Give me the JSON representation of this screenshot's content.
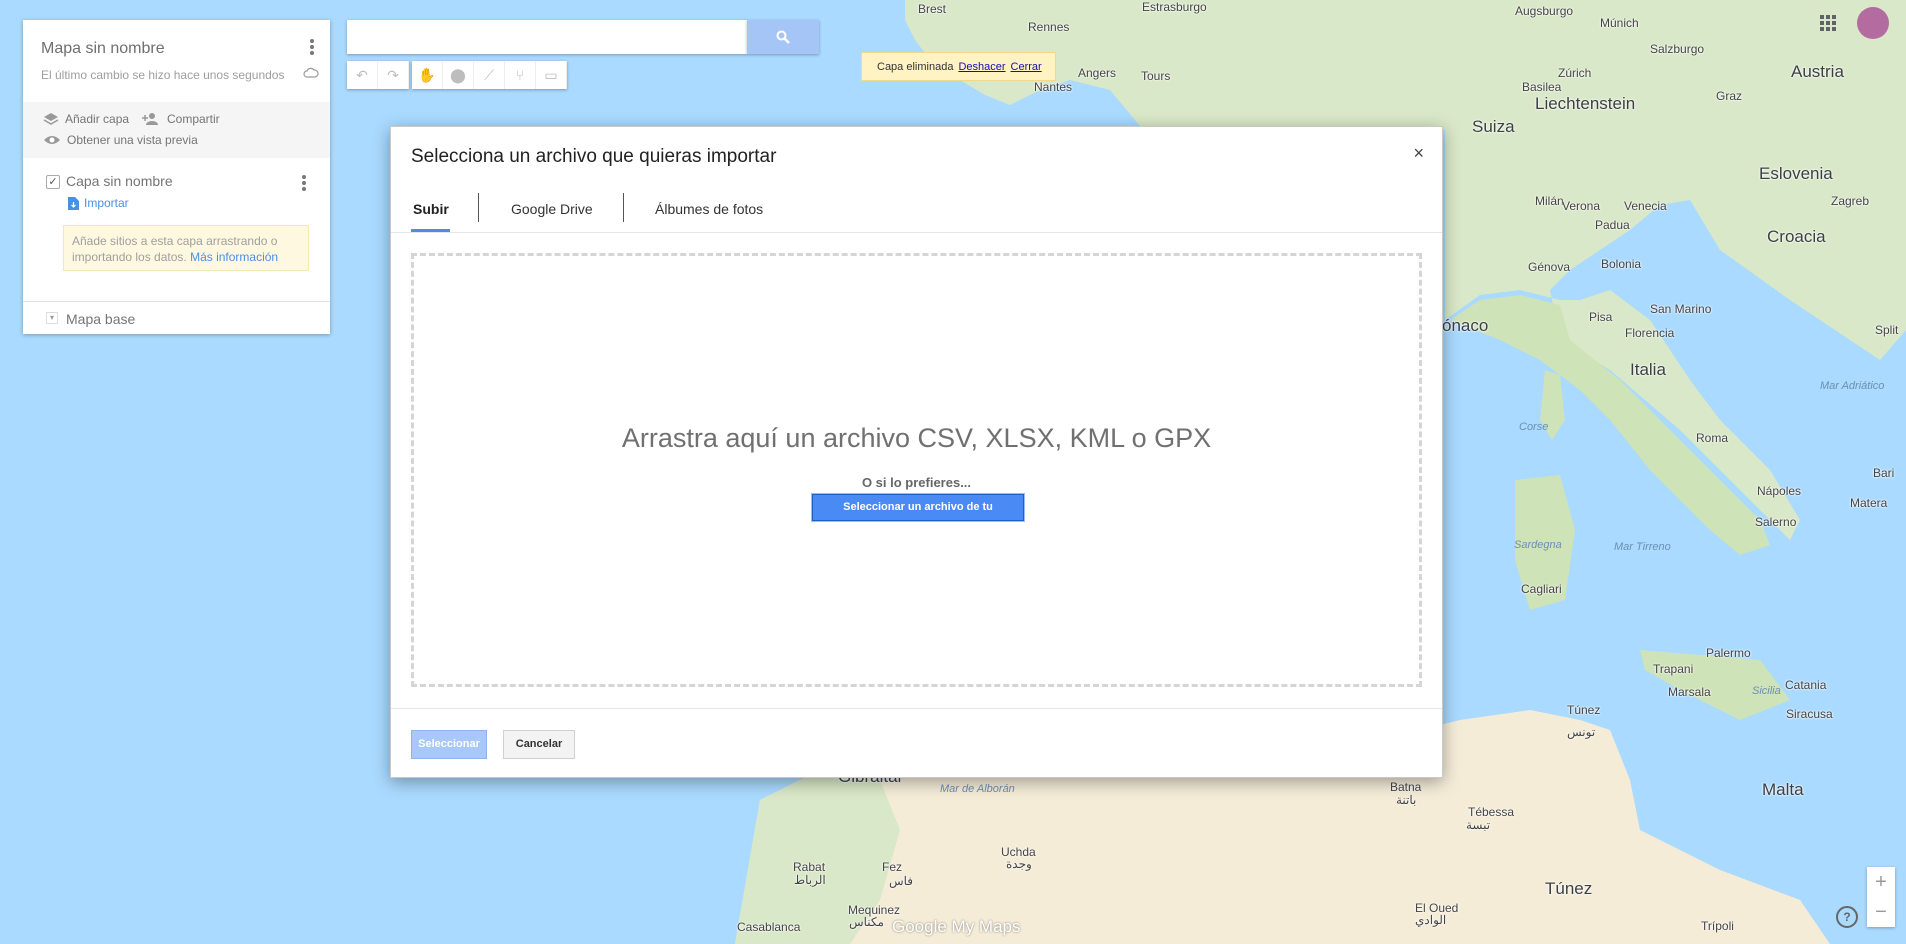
{
  "panel": {
    "title": "Mapa sin nombre",
    "subtitle": "El último cambio se hizo hace unos segundos",
    "actions": {
      "add_layer": "Añadir capa",
      "share": "Compartir",
      "preview": "Obtener una vista previa"
    },
    "layer": {
      "name": "Capa sin nombre",
      "import": "Importar",
      "hint": "Añade sitios a esta capa arrastrando o importando los datos.",
      "hint_link": "Más información"
    },
    "basemap": "Mapa base"
  },
  "search": {
    "placeholder": ""
  },
  "notice": {
    "text": "Capa eliminada",
    "undo": "Deshacer",
    "close": "Cerrar"
  },
  "modal": {
    "title": "Selecciona un archivo que quieras importar",
    "close_glyph": "×",
    "tabs": [
      "Subir",
      "Google Drive",
      "Álbumes de fotos"
    ],
    "drop_text": "Arrastra aquí un archivo CSV, XLSX, KML o GPX",
    "or_text": "O si lo prefieres...",
    "pick_button": "Seleccionar un archivo de tu dispositivo",
    "select_button": "Seleccionar",
    "cancel_button": "Cancelar"
  },
  "map": {
    "brand": "Google My Maps",
    "zoom_in": "+",
    "zoom_out": "−",
    "help": "?",
    "labels": [
      {
        "text": "Brest",
        "cls": "city"
      },
      {
        "text": "Rennes",
        "cls": "city"
      },
      {
        "text": "Nantes",
        "cls": "city"
      },
      {
        "text": "Angers",
        "cls": "city"
      },
      {
        "text": "Tours",
        "cls": "city"
      },
      {
        "text": "Estrasburgo",
        "cls": "city"
      },
      {
        "text": "Augsburgo",
        "cls": "city"
      },
      {
        "text": "Múnich",
        "cls": "city"
      },
      {
        "text": "Salzburgo",
        "cls": "city"
      },
      {
        "text": "Basilea",
        "cls": "city"
      },
      {
        "text": "Zúrich",
        "cls": "city"
      },
      {
        "text": "Liechtenstein",
        "cls": "country"
      },
      {
        "text": "Austria",
        "cls": "country"
      },
      {
        "text": "Graz",
        "cls": "city"
      },
      {
        "text": "Suiza",
        "cls": "country"
      },
      {
        "text": "Eslovenia",
        "cls": "country"
      },
      {
        "text": "Zagreb",
        "cls": "city"
      },
      {
        "text": "Milán",
        "cls": "city"
      },
      {
        "text": "Verona",
        "cls": "city"
      },
      {
        "text": "Venecia",
        "cls": "city"
      },
      {
        "text": "Padua",
        "cls": "city"
      },
      {
        "text": "Croacia",
        "cls": "country"
      },
      {
        "text": "Génova",
        "cls": "city"
      },
      {
        "text": "Bolonia",
        "cls": "city"
      },
      {
        "text": "ónaco",
        "cls": "country"
      },
      {
        "text": "San Marino",
        "cls": "city"
      },
      {
        "text": "Pisa",
        "cls": "city"
      },
      {
        "text": "Florencia",
        "cls": "city"
      },
      {
        "text": "Split",
        "cls": "city"
      },
      {
        "text": "Italia",
        "cls": "country"
      },
      {
        "text": "Mar Adriático",
        "cls": "sea"
      },
      {
        "text": "Corse",
        "cls": "sea"
      },
      {
        "text": "Roma",
        "cls": "city"
      },
      {
        "text": "Bari",
        "cls": "city"
      },
      {
        "text": "Nápoles",
        "cls": "city"
      },
      {
        "text": "Matera",
        "cls": "city"
      },
      {
        "text": "Salerno",
        "cls": "city"
      },
      {
        "text": "Sardegna",
        "cls": "sea"
      },
      {
        "text": "Mar Tirreno",
        "cls": "sea"
      },
      {
        "text": "Cagliari",
        "cls": "city"
      },
      {
        "text": "Palermo",
        "cls": "city"
      },
      {
        "text": "Trapani",
        "cls": "city"
      },
      {
        "text": "Marsala",
        "cls": "city"
      },
      {
        "text": "Sicilia",
        "cls": "sea"
      },
      {
        "text": "Catania",
        "cls": "city"
      },
      {
        "text": "Siracusa",
        "cls": "city"
      },
      {
        "text": "Túnez",
        "cls": "city"
      },
      {
        "text": "تونس",
        "cls": "city"
      },
      {
        "text": "Malta",
        "cls": "country"
      },
      {
        "text": "Gibraltar",
        "cls": "country"
      },
      {
        "text": "Mar de Alborán",
        "cls": "sea"
      },
      {
        "text": "Batna",
        "cls": "city"
      },
      {
        "text": "باتنة",
        "cls": "city"
      },
      {
        "text": "Tébessa",
        "cls": "city"
      },
      {
        "text": "تبسة",
        "cls": "city"
      },
      {
        "text": "Uchda",
        "cls": "city"
      },
      {
        "text": "وجدة",
        "cls": "city"
      },
      {
        "text": "Rabat",
        "cls": "city"
      },
      {
        "text": "الرباط",
        "cls": "city"
      },
      {
        "text": "Fez",
        "cls": "city"
      },
      {
        "text": "فاس",
        "cls": "city"
      },
      {
        "text": "Mequinez",
        "cls": "city"
      },
      {
        "text": "مكناس",
        "cls": "city"
      },
      {
        "text": "Casablanca",
        "cls": "city"
      },
      {
        "text": "Túnez",
        "cls": "country"
      },
      {
        "text": "El Oued",
        "cls": "city"
      },
      {
        "text": "الوادي",
        "cls": "city"
      },
      {
        "text": "Trípoli",
        "cls": "city"
      }
    ]
  }
}
